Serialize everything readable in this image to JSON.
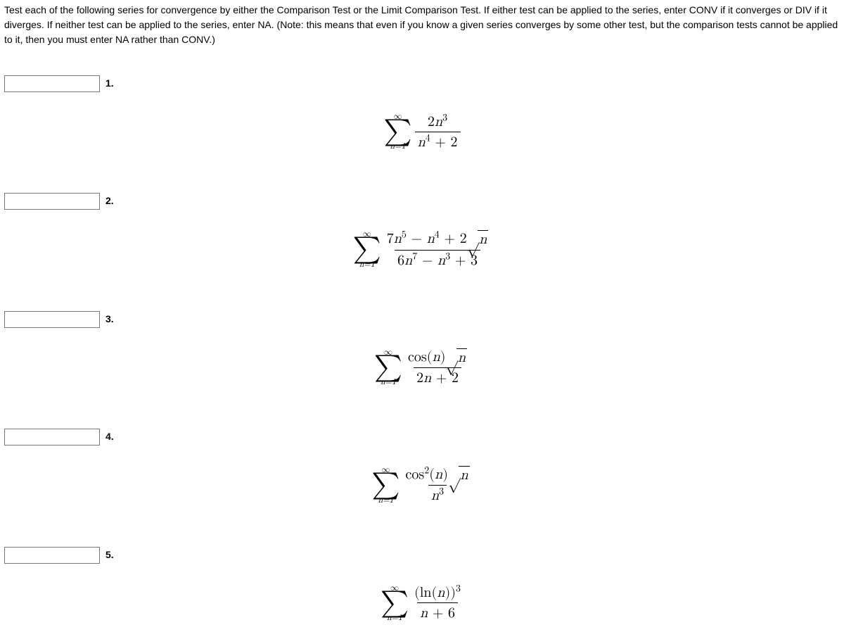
{
  "instructions": "Test each of the following series for convergence by either the Comparison Test or the Limit Comparison Test. If either test can be applied to the series, enter CONV if it converges or DIV if it diverges. If neither test can be applied to the series, enter NA. (Note: this means that even if you know a given series converges by some other test, but the comparison tests cannot be applied to it, then you must enter NA rather than CONV.)",
  "problems": {
    "p1": {
      "label": "1.",
      "value": ""
    },
    "p2": {
      "label": "2.",
      "value": ""
    },
    "p3": {
      "label": "3.",
      "value": ""
    },
    "p4": {
      "label": "4.",
      "value": ""
    },
    "p5": {
      "label": "5.",
      "value": ""
    }
  },
  "sigma": {
    "top": "∞",
    "bot": "n=1",
    "symbol": "∑"
  },
  "formulas": {
    "f1": {
      "num_a": "2",
      "num_var": "n",
      "num_exp": "3",
      "den_var": "n",
      "den_exp": "4",
      "den_plus": " + 2"
    },
    "f2": {
      "num": {
        "c1": "7",
        "v1": "n",
        "e1": "5",
        "op1": " − ",
        "v2": "n",
        "e2": "4",
        "op2": " + 2",
        "sqrt": "n"
      },
      "den": {
        "c1": "6",
        "v1": "n",
        "e1": "7",
        "op1": " − ",
        "v2": "n",
        "e2": "3",
        "op2": " + 3"
      }
    },
    "f3": {
      "num_fn": "cos(",
      "num_var": "n",
      "num_close": ")",
      "sqrt": "n",
      "den_a": "2",
      "den_var": "n",
      "den_plus": " + 2"
    },
    "f4": {
      "num_fn": "cos",
      "num_exp": "2",
      "num_open": "(",
      "num_var": "n",
      "num_close": ")",
      "sqrt": "n",
      "den_var": "n",
      "den_exp": "3"
    },
    "f5": {
      "num_open": "(ln(",
      "num_var": "n",
      "num_close": "))",
      "num_exp": "3",
      "den_var": "n",
      "den_plus": " + 6"
    }
  }
}
